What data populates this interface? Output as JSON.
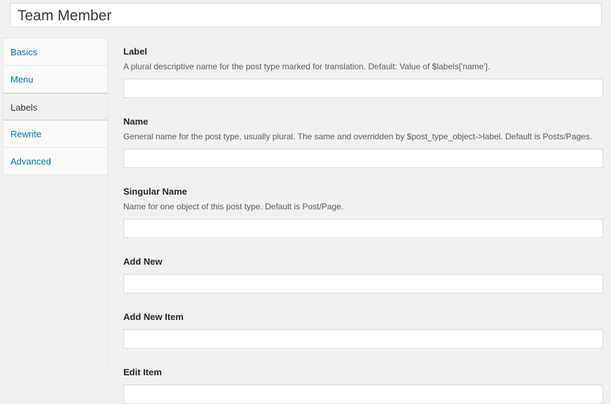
{
  "post_title": {
    "value": "Team Member"
  },
  "tabs": [
    {
      "label": "Basics"
    },
    {
      "label": "Menu"
    },
    {
      "label": "Labels"
    },
    {
      "label": "Rewrite"
    },
    {
      "label": "Advanced"
    }
  ],
  "active_tab": "Labels",
  "fields": [
    {
      "label": "Label",
      "description": "A plural descriptive name for the post type marked for translation. Default: Value of $labels['name'].",
      "value": ""
    },
    {
      "label": "Name",
      "description": "General name for the post type, usually plural. The same and overridden by $post_type_object->label. Default is Posts/Pages.",
      "value": ""
    },
    {
      "label": "Singular Name",
      "description": "Name for one object of this post type. Default is Post/Page.",
      "value": ""
    },
    {
      "label": "Add New",
      "description": "",
      "value": ""
    },
    {
      "label": "Add New Item",
      "description": "",
      "value": ""
    },
    {
      "label": "Edit Item",
      "description": "",
      "value": ""
    }
  ],
  "colors": {
    "link": "#0073aa",
    "background": "#f1f1f1",
    "input_border": "#dddddd"
  }
}
